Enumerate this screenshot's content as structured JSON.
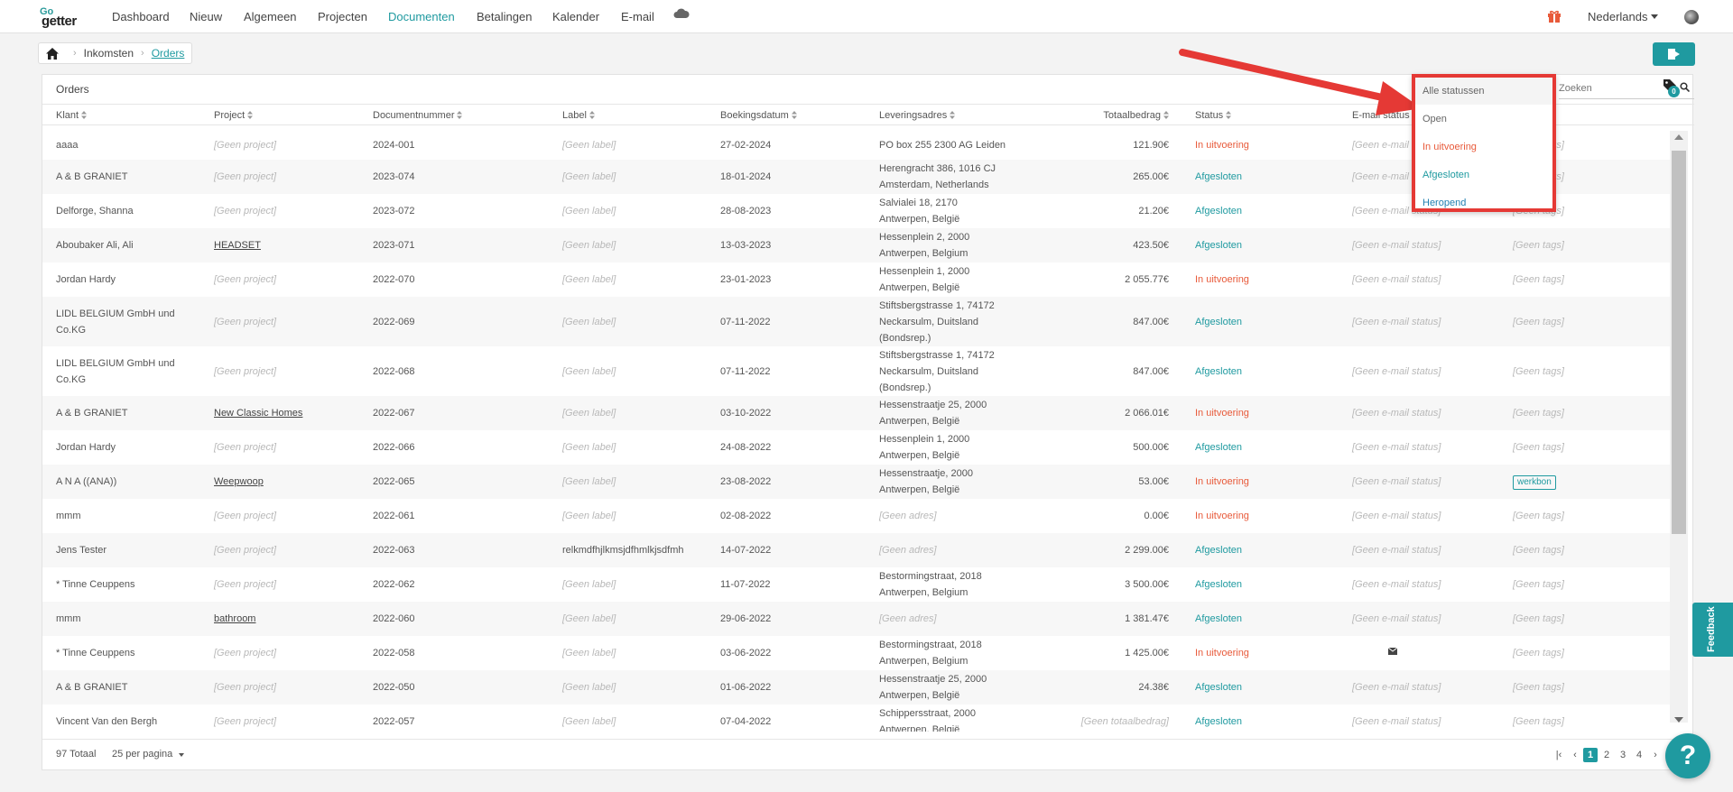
{
  "nav": {
    "logo_top": "Go",
    "logo_bottom": "getter",
    "items": [
      "Dashboard",
      "Nieuw",
      "Algemeen",
      "Projecten",
      "Documenten",
      "Betalingen",
      "Kalender",
      "E-mail"
    ],
    "active": "Documenten",
    "language": "Nederlands"
  },
  "breadcrumb": {
    "parent": "Inkomsten",
    "current": "Orders"
  },
  "card": {
    "title": "Orders",
    "search_placeholder": "Zoeken",
    "tag_count": "0"
  },
  "columns": [
    "Klant",
    "Project",
    "Documentnummer",
    "Label",
    "Boekingsdatum",
    "Leveringsadres",
    "Totaalbedrag",
    "Status",
    "E-mail status",
    "Tags"
  ],
  "rows": [
    {
      "klant": [
        "aaaa"
      ],
      "project": "[Geen project]",
      "nr": "2024-001",
      "label": "[Geen label]",
      "datum": "27-02-2024",
      "adres": [
        "PO box 255 2300 AG Leiden"
      ],
      "totaal": "121.90€",
      "status": "In uitvoering",
      "email": "[Geen e-mail status]",
      "tags": "[Geen tags]"
    },
    {
      "klant": [
        "A & B GRANIET"
      ],
      "project": "[Geen project]",
      "nr": "2023-074",
      "label": "[Geen label]",
      "datum": "18-01-2024",
      "adres": [
        "Herengracht 386, 1016 CJ",
        "Amsterdam, Netherlands"
      ],
      "totaal": "265.00€",
      "status": "Afgesloten",
      "email": "[Geen e-mail status]",
      "tags": "[Geen tags]"
    },
    {
      "klant": [
        "Delforge, Shanna"
      ],
      "project": "[Geen project]",
      "nr": "2023-072",
      "label": "[Geen label]",
      "datum": "28-08-2023",
      "adres": [
        "Salvialei 18, 2170",
        "Antwerpen, België"
      ],
      "totaal": "21.20€",
      "status": "Afgesloten",
      "email": "[Geen e-mail status]",
      "tags": "[Geen tags]"
    },
    {
      "klant": [
        "Aboubaker Ali, Ali"
      ],
      "project": "HEADSET",
      "nr": "2023-071",
      "label": "[Geen label]",
      "datum": "13-03-2023",
      "adres": [
        "Hessenplein 2, 2000",
        "Antwerpen, Belgium"
      ],
      "totaal": "423.50€",
      "status": "Afgesloten",
      "email": "[Geen e-mail status]",
      "tags": "[Geen tags]"
    },
    {
      "klant": [
        "Jordan Hardy"
      ],
      "project": "[Geen project]",
      "nr": "2022-070",
      "label": "[Geen label]",
      "datum": "23-01-2023",
      "adres": [
        "Hessenplein 1, 2000",
        "Antwerpen, België"
      ],
      "totaal": "2 055.77€",
      "status": "In uitvoering",
      "email": "[Geen e-mail status]",
      "tags": "[Geen tags]"
    },
    {
      "klant": [
        "LIDL BELGIUM GmbH und",
        "Co.KG"
      ],
      "project": "[Geen project]",
      "nr": "2022-069",
      "label": "[Geen label]",
      "datum": "07-11-2022",
      "adres": [
        "Stiftsbergstrasse 1, 74172",
        "Neckarsulm, Duitsland",
        "(Bondsrep.)"
      ],
      "totaal": "847.00€",
      "status": "Afgesloten",
      "email": "[Geen e-mail status]",
      "tags": "[Geen tags]"
    },
    {
      "klant": [
        "LIDL BELGIUM GmbH und",
        "Co.KG"
      ],
      "project": "[Geen project]",
      "nr": "2022-068",
      "label": "[Geen label]",
      "datum": "07-11-2022",
      "adres": [
        "Stiftsbergstrasse 1, 74172",
        "Neckarsulm, Duitsland",
        "(Bondsrep.)"
      ],
      "totaal": "847.00€",
      "status": "Afgesloten",
      "email": "[Geen e-mail status]",
      "tags": "[Geen tags]"
    },
    {
      "klant": [
        "A & B GRANIET"
      ],
      "project": "New Classic Homes",
      "nr": "2022-067",
      "label": "[Geen label]",
      "datum": "03-10-2022",
      "adres": [
        "Hessenstraatje 25, 2000",
        "Antwerpen, België"
      ],
      "totaal": "2 066.01€",
      "status": "In uitvoering",
      "email": "[Geen e-mail status]",
      "tags": "[Geen tags]"
    },
    {
      "klant": [
        "Jordan Hardy"
      ],
      "project": "[Geen project]",
      "nr": "2022-066",
      "label": "[Geen label]",
      "datum": "24-08-2022",
      "adres": [
        "Hessenplein 1, 2000",
        "Antwerpen, België"
      ],
      "totaal": "500.00€",
      "status": "Afgesloten",
      "email": "[Geen e-mail status]",
      "tags": "[Geen tags]"
    },
    {
      "klant": [
        "A N A ((ANA))"
      ],
      "project": "Weepwoop",
      "nr": "2022-065",
      "label": "[Geen label]",
      "datum": "23-08-2022",
      "adres": [
        "Hessenstraatje, 2000",
        "Antwerpen, België"
      ],
      "totaal": "53.00€",
      "status": "In uitvoering",
      "email": "[Geen e-mail status]",
      "tags": "werkbon"
    },
    {
      "klant": [
        "mmm"
      ],
      "project": "[Geen project]",
      "nr": "2022-061",
      "label": "[Geen label]",
      "datum": "02-08-2022",
      "adres": [
        "[Geen adres]"
      ],
      "totaal": "0.00€",
      "status": "In uitvoering",
      "email": "[Geen e-mail status]",
      "tags": "[Geen tags]"
    },
    {
      "klant": [
        "Jens Tester"
      ],
      "project": "[Geen project]",
      "nr": "2022-063",
      "label": "relkmdfhjlkmsjdfhmlkjsdfmh",
      "datum": "14-07-2022",
      "adres": [
        "[Geen adres]"
      ],
      "totaal": "2 299.00€",
      "status": "Afgesloten",
      "email": "[Geen e-mail status]",
      "tags": "[Geen tags]"
    },
    {
      "klant": [
        "* Tinne Ceuppens"
      ],
      "project": "[Geen project]",
      "nr": "2022-062",
      "label": "[Geen label]",
      "datum": "11-07-2022",
      "adres": [
        "Bestormingstraat, 2018",
        "Antwerpen, Belgium"
      ],
      "totaal": "3 500.00€",
      "status": "Afgesloten",
      "email": "[Geen e-mail status]",
      "tags": "[Geen tags]"
    },
    {
      "klant": [
        "mmm"
      ],
      "project": "bathroom",
      "nr": "2022-060",
      "label": "[Geen label]",
      "datum": "29-06-2022",
      "adres": [
        "[Geen adres]"
      ],
      "totaal": "1 381.47€",
      "status": "Afgesloten",
      "email": "[Geen e-mail status]",
      "tags": "[Geen tags]"
    },
    {
      "klant": [
        "* Tinne Ceuppens"
      ],
      "project": "[Geen project]",
      "nr": "2022-058",
      "label": "[Geen label]",
      "datum": "03-06-2022",
      "adres": [
        "Bestormingstraat, 2018",
        "Antwerpen, Belgium"
      ],
      "totaal": "1 425.00€",
      "status": "In uitvoering",
      "email": "mail-icon",
      "tags": "[Geen tags]"
    },
    {
      "klant": [
        "A & B GRANIET"
      ],
      "project": "[Geen project]",
      "nr": "2022-050",
      "label": "[Geen label]",
      "datum": "01-06-2022",
      "adres": [
        "Hessenstraatje 25, 2000",
        "Antwerpen, België"
      ],
      "totaal": "24.38€",
      "status": "Afgesloten",
      "email": "[Geen e-mail status]",
      "tags": "[Geen tags]"
    },
    {
      "klant": [
        "Vincent Van den Bergh"
      ],
      "project": "[Geen project]",
      "nr": "2022-057",
      "label": "[Geen label]",
      "datum": "07-04-2022",
      "adres": [
        "Schippersstraat, 2000",
        "Antwerpen, België"
      ],
      "totaal": "[Geen totaalbedrag]",
      "status": "Afgesloten",
      "email": "[Geen e-mail status]",
      "tags": "[Geen tags]"
    }
  ],
  "footer": {
    "total": "97 Totaal",
    "per_page": "25 per pagina",
    "pages": [
      "1",
      "2",
      "3",
      "4"
    ],
    "current_page": "1"
  },
  "dropdown": {
    "options": [
      "Alle statussen",
      "Open",
      "In uitvoering",
      "Afgesloten",
      "Heropend"
    ]
  },
  "feedback": "Feedback",
  "help": "?",
  "colors": {
    "accent": "#1f9aa0",
    "in_progress": "#e85a3a",
    "highlight": "#e53935"
  }
}
